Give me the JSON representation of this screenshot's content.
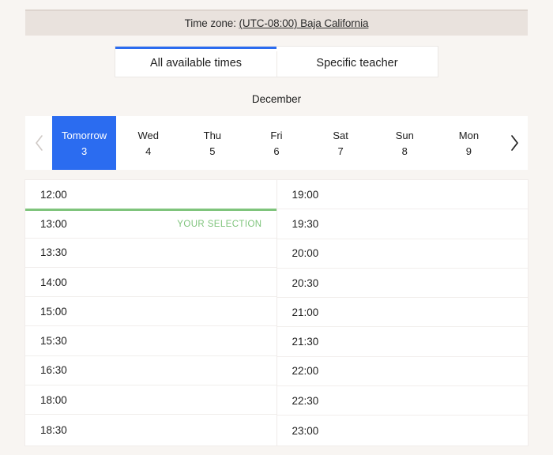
{
  "timezone": {
    "label": "Time zone: ",
    "value": "(UTC-08:00) Baja California"
  },
  "tabs": [
    {
      "label": "All available times",
      "active": true
    },
    {
      "label": "Specific teacher",
      "active": false
    }
  ],
  "calendar": {
    "month": "December",
    "prev_icon": "chevron-left-icon",
    "next_icon": "chevron-right-icon",
    "prev_enabled": false,
    "next_enabled": true,
    "days": [
      {
        "dow": "Tomorrow",
        "num": "3",
        "selected": true
      },
      {
        "dow": "Wed",
        "num": "4",
        "selected": false
      },
      {
        "dow": "Thu",
        "num": "5",
        "selected": false
      },
      {
        "dow": "Fri",
        "num": "6",
        "selected": false
      },
      {
        "dow": "Sat",
        "num": "7",
        "selected": false
      },
      {
        "dow": "Sun",
        "num": "8",
        "selected": false
      },
      {
        "dow": "Mon",
        "num": "9",
        "selected": false
      }
    ]
  },
  "slots": {
    "selection_badge": "YOUR SELECTION",
    "left": [
      {
        "time": "12:00"
      },
      {
        "time": "13:00",
        "selected": true,
        "divider": true
      },
      {
        "time": "13:30"
      },
      {
        "time": "14:00"
      },
      {
        "time": "15:00"
      },
      {
        "time": "15:30"
      },
      {
        "time": "16:30"
      },
      {
        "time": "18:00"
      },
      {
        "time": "18:30"
      }
    ],
    "right": [
      {
        "time": "19:00"
      },
      {
        "time": "19:30"
      },
      {
        "time": "20:00"
      },
      {
        "time": "20:30"
      },
      {
        "time": "21:00"
      },
      {
        "time": "21:30"
      },
      {
        "time": "22:00"
      },
      {
        "time": "22:30"
      },
      {
        "time": "23:00"
      }
    ]
  },
  "colors": {
    "accent_blue": "#2b6cf0",
    "selection_green": "#7fc47c",
    "page_bg": "#f8f5f2",
    "timezone_bg": "#e9e2dd"
  }
}
